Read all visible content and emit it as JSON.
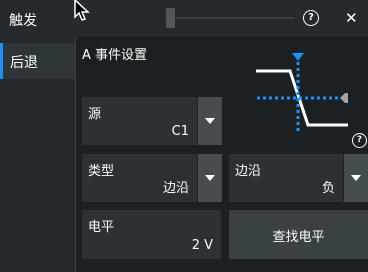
{
  "header": {
    "title": "触发",
    "help_glyph": "?",
    "close_glyph": "✕"
  },
  "sidebar": {
    "back_label": "后退"
  },
  "main": {
    "section_title": "A 事件设置",
    "diagram_info_glyph": "?",
    "source": {
      "label": "源",
      "value": "C1"
    },
    "type": {
      "label": "类型",
      "value": "边沿"
    },
    "edge": {
      "label": "边沿",
      "value": "负"
    },
    "level": {
      "label": "电平",
      "value": "2 V"
    },
    "find_level_label": "查找电平"
  },
  "colors": {
    "accent": "#1e90ff",
    "background": "#1b2022",
    "panel": "#2b3134",
    "dropdown_button": "#464d50"
  }
}
